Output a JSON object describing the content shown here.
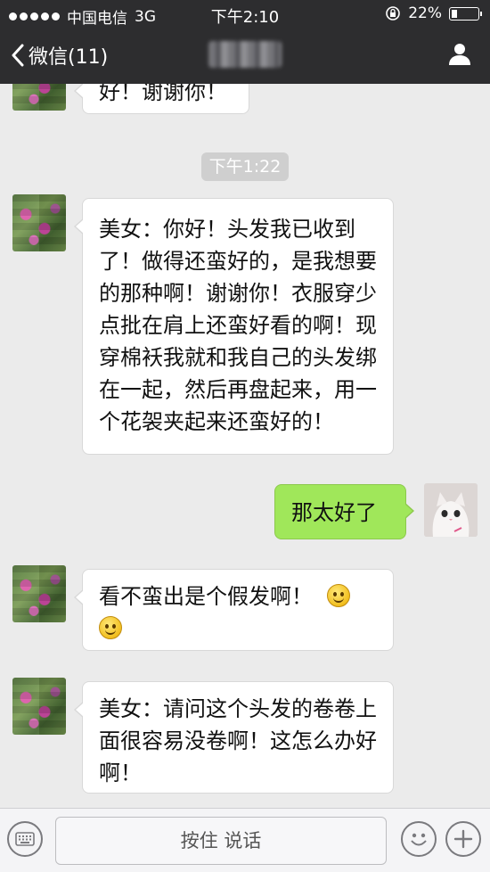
{
  "status_bar": {
    "carrier": "中国电信",
    "network": "3G",
    "time": "下午2:10",
    "battery": "22%"
  },
  "nav": {
    "back_label": "微信(11)"
  },
  "messages": {
    "partial": "好！谢谢你！",
    "timestamp": "下午1:22",
    "msg1": "美女：你好！头发我已收到了！做得还蛮好的，是我想要的那种啊！谢谢你！衣服穿少点批在肩上还蛮好看的啊！现穿棉袄我就和我自己的头发绑在一起，然后再盘起来，用一个花袈夹起来还蛮好的！",
    "msg2": "那太好了",
    "msg3": "看不蛮出是个假发啊！",
    "msg4": "美女：请问这个头发的卷卷上面很容易没卷啊！这怎么办好啊！"
  },
  "input": {
    "talk_label": "按住 说话"
  },
  "colors": {
    "nav_bg": "#2d2d2f",
    "chat_bg": "#ebebeb",
    "bubble_in": "#ffffff",
    "bubble_out": "#a0e75a"
  }
}
